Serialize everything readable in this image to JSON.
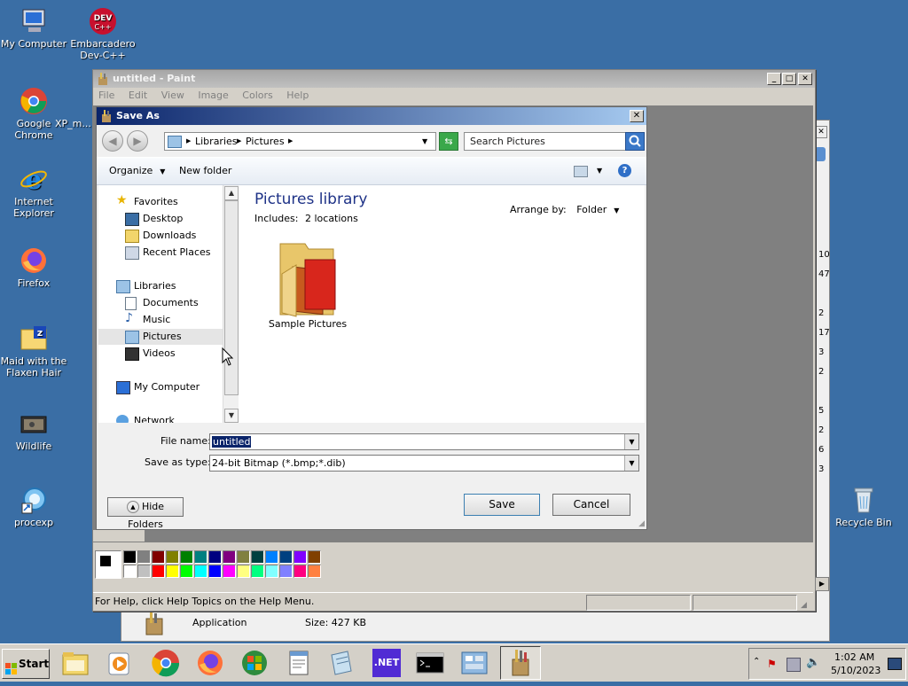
{
  "desktop": {
    "icons": [
      {
        "label": "My Computer"
      },
      {
        "label": "Embarcadero Dev-C++"
      },
      {
        "label": "Google Chrome"
      },
      {
        "label": "XP_m... S..."
      },
      {
        "label": "Internet Explorer"
      },
      {
        "label": "Firefox"
      },
      {
        "label": "Maid with the Flaxen Hair"
      },
      {
        "label": "Wildlife"
      },
      {
        "label": "procexp"
      },
      {
        "label": "Recycle Bin"
      }
    ]
  },
  "background_window": {
    "numbers": [
      "10",
      "47",
      "2",
      "17",
      "3",
      "2",
      "5",
      "2",
      "6",
      "3"
    ],
    "row": {
      "name": "Application",
      "size": "Size: 427 KB"
    }
  },
  "paint": {
    "title": "untitled - Paint",
    "menu": [
      "File",
      "Edit",
      "View",
      "Image",
      "Colors",
      "Help"
    ],
    "status": "For Help, click Help Topics on the Help Menu.",
    "palette_top": [
      "#000000",
      "#808080",
      "#800000",
      "#808000",
      "#008000",
      "#008080",
      "#000080",
      "#800080",
      "#808040",
      "#004040",
      "#0080ff",
      "#004080",
      "#8000ff",
      "#804000"
    ],
    "palette_bottom": [
      "#ffffff",
      "#c0c0c0",
      "#ff0000",
      "#ffff00",
      "#00ff00",
      "#00ffff",
      "#0000ff",
      "#ff00ff",
      "#ffff80",
      "#00ff80",
      "#80ffff",
      "#8080ff",
      "#ff0080",
      "#ff8040"
    ]
  },
  "dialog": {
    "title": "Save As",
    "breadcrumb": [
      "Libraries",
      "Pictures"
    ],
    "search_placeholder": "Search Pictures",
    "toolbar": {
      "organize": "Organize",
      "new_folder": "New folder"
    },
    "nav": {
      "favorites": "Favorites",
      "desktop": "Desktop",
      "downloads": "Downloads",
      "recent": "Recent Places",
      "libraries": "Libraries",
      "documents": "Documents",
      "music": "Music",
      "pictures": "Pictures",
      "videos": "Videos",
      "computer": "My Computer",
      "network": "Network"
    },
    "content": {
      "heading": "Pictures library",
      "includes": "Includes:",
      "locations": "2 locations",
      "arrange_label": "Arrange by:",
      "arrange_value": "Folder",
      "folder": "Sample Pictures"
    },
    "file_name_label": "File name:",
    "file_name_value": "untitled",
    "type_label": "Save as type:",
    "type_value": "24-bit Bitmap (*.bmp;*.dib)",
    "hide_folders": "Hide Folders",
    "save": "Save",
    "cancel": "Cancel"
  },
  "taskbar": {
    "start": "Start",
    "net_label": ".NET",
    "time": "1:02 AM",
    "date": "5/10/2023"
  }
}
